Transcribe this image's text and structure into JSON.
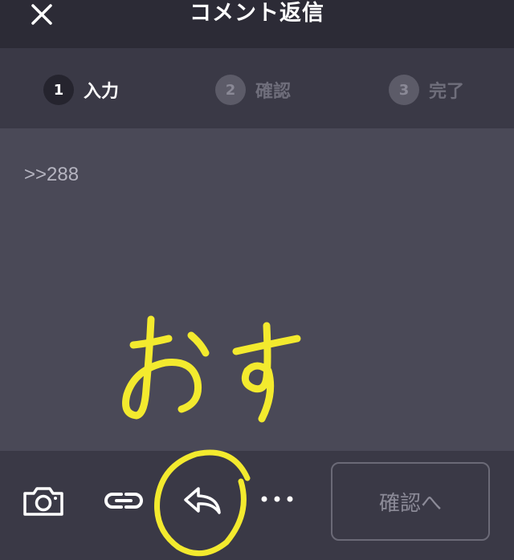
{
  "header": {
    "title": "コメント返信",
    "close_icon": "close-icon"
  },
  "steps": [
    {
      "number": "1",
      "label": "入力",
      "state": "active"
    },
    {
      "number": "2",
      "label": "確認",
      "state": "inactive"
    },
    {
      "number": "3",
      "label": "完了",
      "state": "inactive"
    }
  ],
  "editor": {
    "content": ">>288",
    "handwritten_annotation": "おす"
  },
  "toolbar": {
    "camera_icon": "camera-icon",
    "link_icon": "link-icon",
    "reply_icon": "reply-icon",
    "more_icon": "more-icon",
    "confirm_label": "確認へ"
  },
  "colors": {
    "header_bg": "#2c2b36",
    "steps_bg": "#3a3946",
    "editor_bg": "#4a4957",
    "annotation": "#f3ea2e"
  }
}
